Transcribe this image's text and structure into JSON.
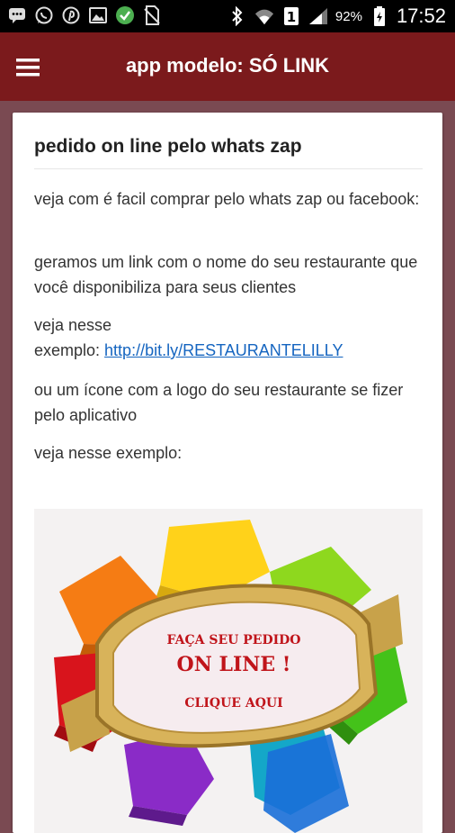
{
  "status_bar": {
    "battery": "92%",
    "time": "17:52",
    "notif_icons": [
      "chat-bubble-icon",
      "whatsapp-icon",
      "pinterest-icon",
      "image-icon",
      "check-circle-icon",
      "no-sim-icon"
    ],
    "sys_icons": [
      "bluetooth-icon",
      "wifi-icon",
      "sim-1-icon",
      "signal-icon",
      "battery-icon"
    ]
  },
  "app_bar": {
    "title": "app modelo: SÓ LINK",
    "menu_icon": "hamburger-menu-icon"
  },
  "post": {
    "title": "pedido on line pelo whats zap",
    "p1": "veja com é facil comprar pelo whats zap ou facebook:",
    "p2": "geramos um link com o nome do seu restaurante que você disponibiliza para seus clientes",
    "p3_line1": "veja nesse",
    "p3_prefix": "exemplo: ",
    "p3_link": "http://bit.ly/RESTAURANTELILLY",
    "p4": "ou um ícone com a logo do seu restaurante se fizer pelo aplicativo",
    "p5": "veja nesse exemplo:"
  },
  "promo_image": {
    "line1": "FAÇA SEU PEDIDO",
    "line2": "ON LINE !",
    "line3": "CLIQUE AQUI",
    "colors": {
      "orange": "#f57c14",
      "yellow": "#ffd21a",
      "lime": "#8ed81e",
      "green": "#44c21a",
      "teal": "#14a7c8",
      "blue": "#1a6fd8",
      "purple": "#8a2bc7",
      "red": "#d8141c",
      "gold": "#c8a24a",
      "ribbon_text": "#c0141a"
    }
  },
  "colors": {
    "app_bar": "#7b1a1c",
    "background": "#7a4a52",
    "link": "#1565c0"
  }
}
